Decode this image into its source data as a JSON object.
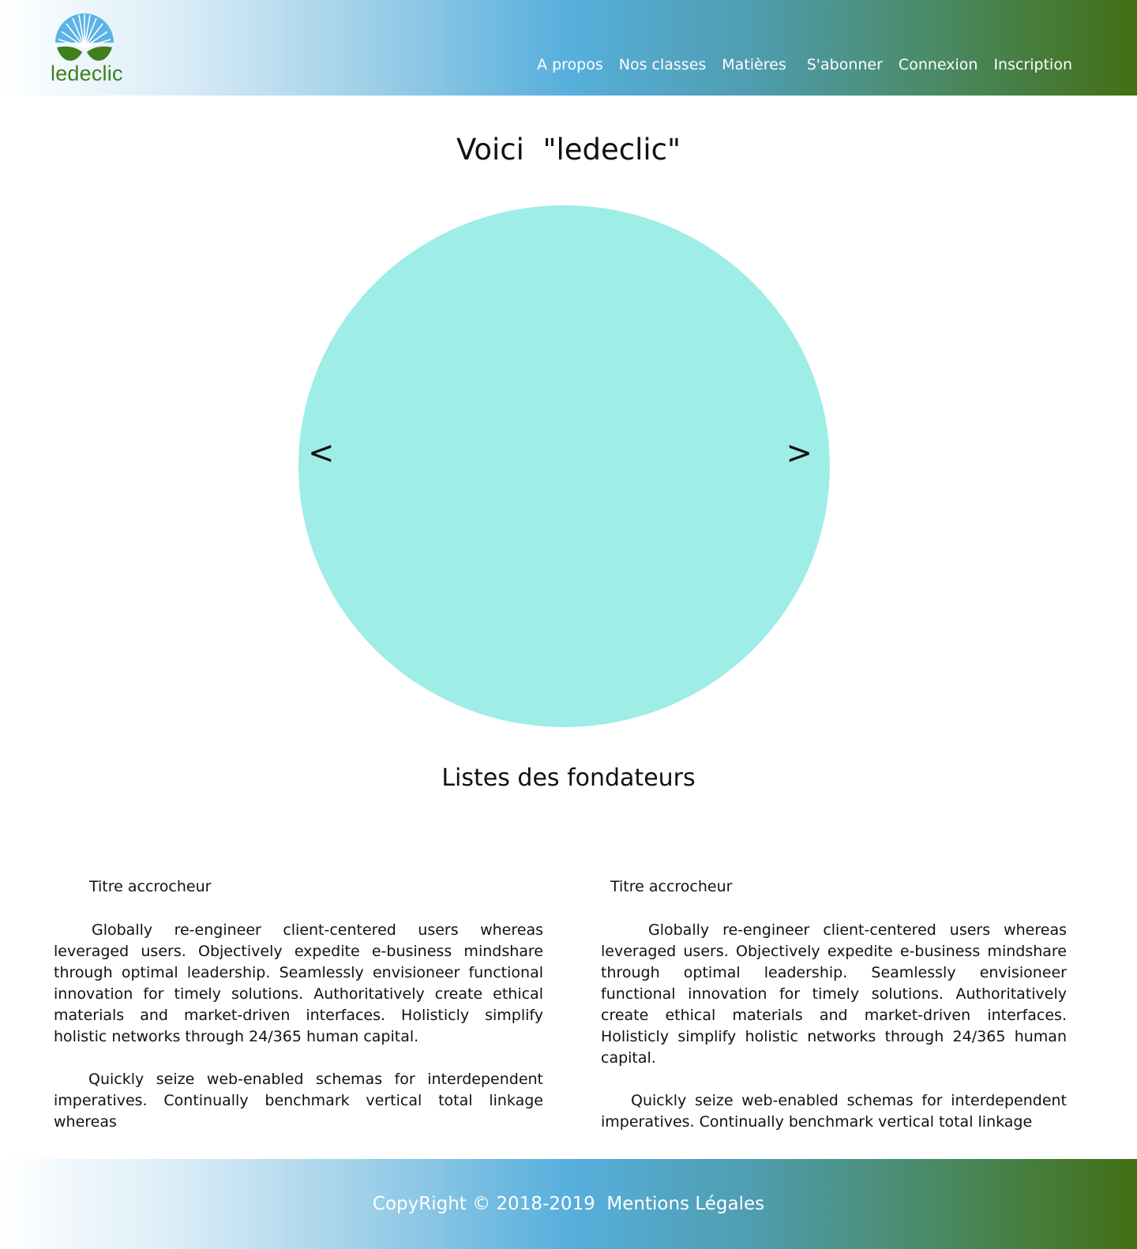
{
  "brand": {
    "name": "ledeclic",
    "logo_icon": "sunrise-leaves-icon",
    "colors": {
      "sun": "#5ab4e5",
      "leaf": "#3f7f1e",
      "text": "#3f7f1e"
    }
  },
  "nav": {
    "items": [
      {
        "label": "A propos"
      },
      {
        "label": "Nos classes"
      },
      {
        "label": "Matières"
      },
      {
        "label": "S'abonner"
      },
      {
        "label": "Connexion"
      },
      {
        "label": "Inscription"
      }
    ]
  },
  "main": {
    "title": "Voici  \"ledeclic\"",
    "carousel": {
      "prev_label": "<",
      "next_label": ">",
      "color": "#9eede7"
    },
    "section_title": "Listes des fondateurs",
    "columns": [
      {
        "title": "Titre accrocheur",
        "paragraph1": "Globally re-engineer client-centered users whereas leveraged users. Objectively expedite e-business mindshare through optimal leadership. Seamlessly envisioneer functional innovation for timely solutions. Authoritatively create ethical materials and market-driven interfaces. Holisticly simplify holistic networks through 24/365 human capital.",
        "paragraph2": "Quickly seize web-enabled schemas for interdependent imperatives. Continually benchmark vertical total linkage whereas"
      },
      {
        "title": "Titre accrocheur",
        "paragraph1": "Globally re-engineer client-centered users whereas leveraged users. Objectively expedite e-business mindshare through optimal leadership. Seamlessly envisioneer functional innovation for timely solutions. Authoritatively create ethical materials and market-driven interfaces. Holisticly simplify holistic networks through 24/365 human capital.",
        "paragraph2": "Quickly seize web-enabled schemas for interdependent imperatives. Continually benchmark vertical total linkage"
      }
    ]
  },
  "footer": {
    "text": "CopyRight © 2018-2019  Mentions Légales"
  }
}
